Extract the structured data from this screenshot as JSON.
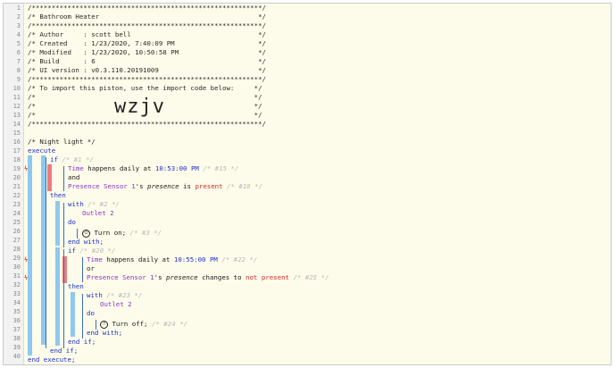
{
  "lines": [
    {
      "n": "1",
      "t": "/**********************************************************/"
    },
    {
      "n": "2",
      "t": "/* Bathroom Heater                                        */"
    },
    {
      "n": "3",
      "t": "/**********************************************************/"
    },
    {
      "n": "4",
      "t": "/* Author     : scott bell                                */"
    },
    {
      "n": "5",
      "t": "/* Created    : 1/23/2020, 7:40:09 PM                     */"
    },
    {
      "n": "6",
      "t": "/* Modified   : 1/23/2020, 10:50:58 PM                    */"
    },
    {
      "n": "7",
      "t": "/* Build      : 6                                         */"
    },
    {
      "n": "8",
      "t": "/* UI version : v0.3.110.20191009                         */"
    },
    {
      "n": "9",
      "t": "/**********************************************************/"
    },
    {
      "n": "10",
      "t": "/* To import this piston, use the import code below:     */"
    },
    {
      "n": "11",
      "t": "/*                                                       */"
    },
    {
      "n": "12",
      "t": "/*                                                       */"
    },
    {
      "n": "13",
      "t": "/*                                                       */"
    },
    {
      "n": "14",
      "t": "/**********************************************************/"
    }
  ],
  "import_code": "wzjv",
  "body": {
    "l16": "/* Night light */",
    "execute": "execute",
    "if": "if",
    "c1": "/* #1 */",
    "time": "Time",
    "happens_daily_at": " happens daily at ",
    "t1": "10:53:00 PM",
    "c15": "/* #15 */",
    "and": "and",
    "presence_sensor": "Presence Sensor 1",
    "s_apos": "'s ",
    "presence": "presence",
    "is": " is ",
    "present": "present",
    "c18": "/* #18 */",
    "then": "then",
    "with": "with",
    "c2": "/* #2 */",
    "outlet": "Outlet 2",
    "do": "do",
    "turn_on": "Turn on;",
    "c3": "/* #3 */",
    "end_with": "end with;",
    "c20": "/* #20 */",
    "t2": "10:55:00 PM",
    "c22": "/* #22 */",
    "or": "or",
    "changes_to": " changes to ",
    "not_present": "not present",
    "c25": "/* #25 */",
    "c23": "/* #23 */",
    "turn_off": "Turn off;",
    "c24": "/* #24 */",
    "end_if": "end if;",
    "end_execute": "end execute;"
  },
  "gutter_numbers": [
    "1",
    "2",
    "3",
    "4",
    "5",
    "6",
    "7",
    "8",
    "9",
    "10",
    "11",
    "12",
    "13",
    "14",
    "15",
    "16",
    "17",
    "18",
    "19",
    "20",
    "21",
    "22",
    "23",
    "24",
    "25",
    "26",
    "27",
    "28",
    "29",
    "30",
    "31",
    "32",
    "33",
    "34",
    "35",
    "36",
    "37",
    "38",
    "39",
    "40"
  ],
  "flags": {
    "l19": "ϟ",
    "l29": "ϟ",
    "l31": "ϟ"
  },
  "colors": {
    "background": "#fdfcea",
    "keyword": "#1d2fc9",
    "device": "#8a32c9",
    "comment": "#b8b8b8",
    "compare": "#d42a2a",
    "block_bar": "#8ec8f0",
    "trigger_bar": "#ec7c7c"
  }
}
